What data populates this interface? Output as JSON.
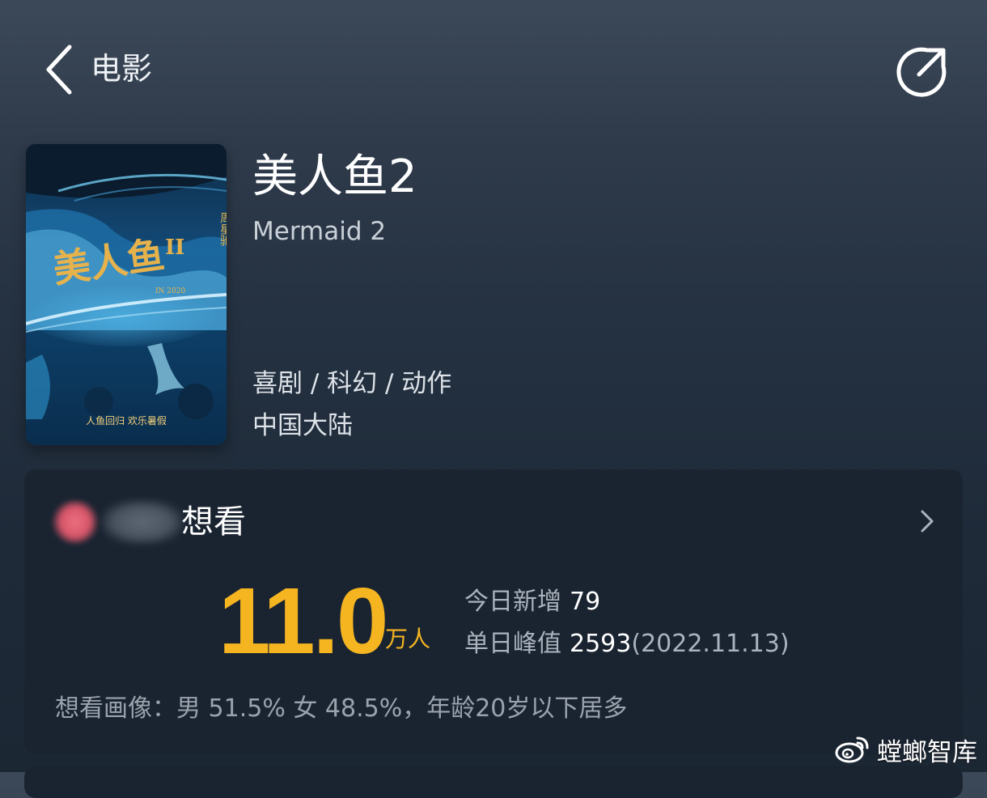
{
  "nav": {
    "back_icon": "chevron-left-icon",
    "title": "电影",
    "share_icon": "share-icon"
  },
  "movie": {
    "title": "美人鱼2",
    "english_title": "Mermaid 2",
    "genre": "喜剧 / 科幻 / 动作",
    "region": "中国大陆",
    "poster": {
      "title_art": "美人鱼",
      "numeral": "II",
      "director": "周星驰",
      "year_text": "IN 2020",
      "tagline": "人鱼回归 欢乐暑假"
    }
  },
  "want_card": {
    "label": "想看",
    "count": "11.0",
    "unit": "万人",
    "today_label": "今日新增",
    "today_value": "79",
    "peak_label": "单日峰值",
    "peak_value": "2593",
    "peak_date": "(2022.11.13)",
    "portrait": "想看画像：男 51.5%  女 48.5%，年龄20岁以下居多",
    "chevron_icon": "chevron-right-icon"
  },
  "watermark": {
    "text": "螳螂智库",
    "icon": "weibo-icon"
  },
  "colors": {
    "accent": "#f5b521",
    "card_bg": "#1a2431"
  }
}
